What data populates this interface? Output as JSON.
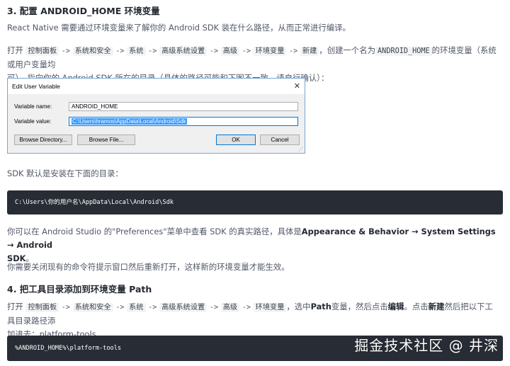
{
  "section3": {
    "heading": "3. 配置 ANDROID_HOME 环境变量",
    "p1": "React Native 需要通过环境变量来了解你的 Android SDK 装在什么路径，从而正常进行编译。",
    "p2": {
      "prefix": "打开",
      "path": [
        "控制面板",
        "系统和安全",
        "系统",
        "高级系统设置",
        "高级",
        "环境变量",
        "新建"
      ],
      "arrow": "->",
      "mid": "，创建一个名为",
      "var": "ANDROID_HOME",
      "line1_tail": "的环境变量（系统或用户变量均",
      "line2": "可），指向你的 Android SDK 所在的目录（具体的路径可能和下图不一致，请自行确认）："
    }
  },
  "dialog": {
    "title": "Edit User Variable",
    "name_label": "Variable name:",
    "name_value": "ANDROID_HOME",
    "value_label": "Variable value:",
    "value_value": "C:\\Users\\hramos\\AppData\\Local\\Android\\Sdk",
    "browse_dir": "Browse Directory...",
    "browse_file": "Browse File...",
    "ok": "OK",
    "cancel": "Cancel",
    "close_glyph": "✕"
  },
  "sdk_default": "SDK 默认是安装在下面的目录：",
  "code1": "C:\\Users\\你的用户名\\AppData\\Local\\Android\\Sdk",
  "p_prefs": {
    "text": "你可以在 Android Studio 的\"Preferences\"菜单中查看 SDK 的真实路径，具体是",
    "bold": "Appearance & Behavior → System Settings → Android",
    "bold2": "SDK",
    "end": "。"
  },
  "p_reopen": "你需要关闭现有的命令符提示窗口然后重新打开，这样新的环境变量才能生效。",
  "section4": {
    "heading": "4. 把工具目录添加到环境变量 Path",
    "prefix": "打开",
    "path": [
      "控制面板",
      "系统和安全",
      "系统",
      "高级系统设置",
      "高级",
      "环境变量"
    ],
    "t1": "，选中",
    "b1": "Path",
    "t2": "变量，然后点击",
    "b2": "编辑",
    "t3": "。点击",
    "b3": "新建",
    "t4": "然后把以下工具目录路径添",
    "line2": "加进去：platform-tools"
  },
  "code2": "%ANDROID_HOME%\\platform-tools",
  "watermark": "掘金技术社区 @ 井深"
}
